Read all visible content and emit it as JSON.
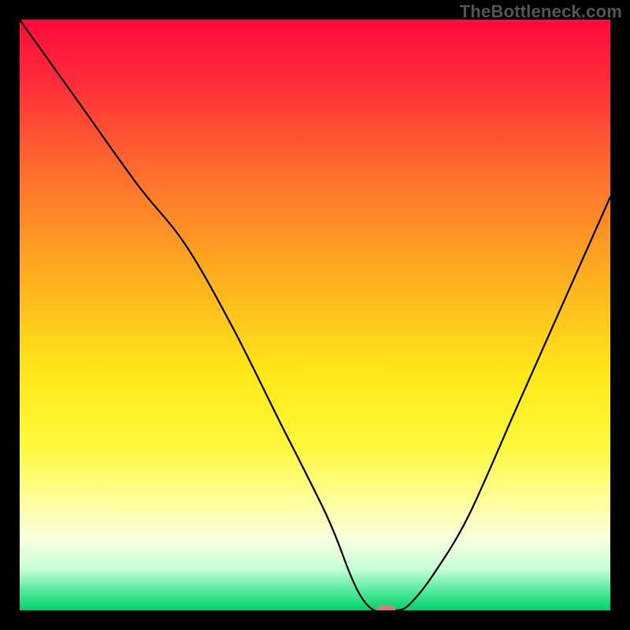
{
  "watermark": "TheBottleneck.com",
  "chart_data": {
    "type": "line",
    "title": "",
    "xlabel": "",
    "ylabel": "",
    "xlim": [
      0,
      100
    ],
    "ylim": [
      0,
      100
    ],
    "grid": false,
    "series": [
      {
        "name": "bottleneck-curve",
        "x": [
          0,
          10,
          20,
          28,
          36,
          44,
          52,
          56,
          58,
          60,
          62,
          64,
          66,
          70,
          76,
          84,
          92,
          100
        ],
        "y": [
          100,
          86,
          72,
          62,
          48,
          32,
          16,
          6,
          2,
          0,
          0,
          0,
          1,
          6,
          16,
          34,
          52,
          70
        ]
      }
    ],
    "marker": {
      "name": "optimal-point",
      "x": 62,
      "y": 0,
      "color": "#d87b7b"
    },
    "gradient_stops": [
      {
        "offset": 0.0,
        "color": "#ff0a3c"
      },
      {
        "offset": 0.1,
        "color": "#ff2a3a"
      },
      {
        "offset": 0.25,
        "color": "#ff6a2e"
      },
      {
        "offset": 0.45,
        "color": "#ffb41e"
      },
      {
        "offset": 0.6,
        "color": "#ffe81a"
      },
      {
        "offset": 0.72,
        "color": "#fff83a"
      },
      {
        "offset": 0.82,
        "color": "#ffffa0"
      },
      {
        "offset": 0.88,
        "color": "#f8ffe0"
      },
      {
        "offset": 0.93,
        "color": "#c6ffd6"
      },
      {
        "offset": 0.97,
        "color": "#4be89a"
      },
      {
        "offset": 1.0,
        "color": "#00d26a"
      }
    ]
  }
}
